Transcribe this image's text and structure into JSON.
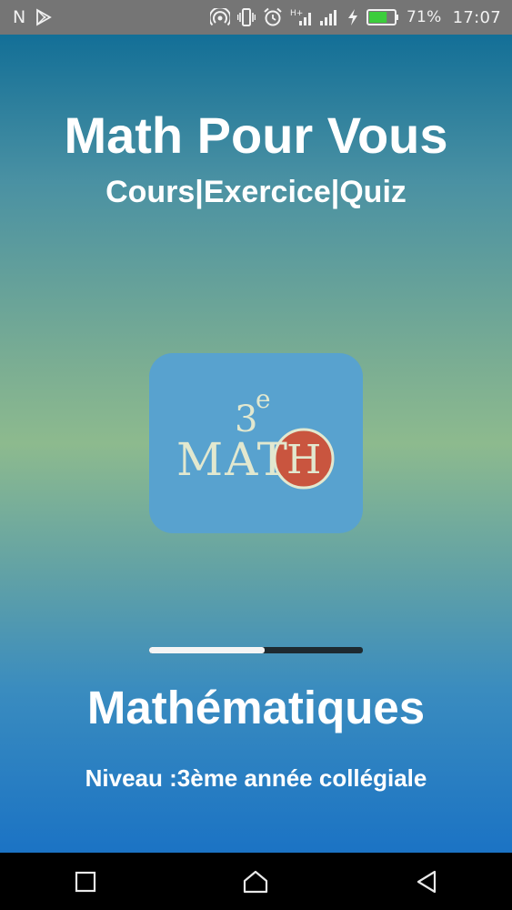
{
  "status_bar": {
    "left_icons": [
      "n-icon",
      "play-store-icon"
    ],
    "right_icons": [
      "hotspot-icon",
      "vibrate-icon",
      "alarm-icon",
      "signal-h-icon",
      "signal-icon",
      "charging-icon",
      "battery-icon"
    ],
    "battery_percent": "71%",
    "battery_level": 0.71,
    "time": "17:07"
  },
  "app": {
    "title": "Math Pour Vous",
    "subtitle": "Cours|Exercice|Quiz",
    "logo": {
      "grade": "3",
      "superscript": "e",
      "word": "MAT",
      "circle_letter": "H"
    },
    "loading_progress": 0.54,
    "subject": "Mathématiques",
    "level": "Niveau :3ème année collégiale"
  },
  "nav_bar": {
    "buttons": [
      "recent-apps-icon",
      "home-icon",
      "back-icon"
    ]
  },
  "colors": {
    "status_bar": "#757575",
    "gradient_top": "#136f97",
    "gradient_mid": "#8dba8e",
    "gradient_bottom": "#1b73c4",
    "logo_bg": "#58a2cf",
    "logo_text": "#e2e8cf",
    "logo_circle": "#c9553f",
    "battery_fill": "#3ccd3c"
  }
}
